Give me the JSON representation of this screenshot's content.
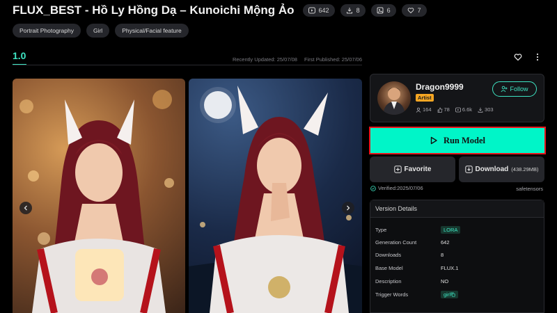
{
  "header": {
    "title": "FLUX_BEST - Hồ Ly Hồng Dạ – Kunoichi Mộng Ảo",
    "stats": [
      {
        "icon": "play-icon",
        "value": "642"
      },
      {
        "icon": "download-icon",
        "value": "8"
      },
      {
        "icon": "image-icon",
        "value": "6"
      },
      {
        "icon": "heart-icon",
        "value": "7"
      }
    ]
  },
  "tags": [
    "Portrait Photography",
    "Girl",
    "Physical/Facial feature"
  ],
  "version": {
    "label": "1.0",
    "recently_updated": "Recently Updated: 25/07/08",
    "first_published": "First Published: 25/07/06"
  },
  "creator": {
    "name": "Dragon9999",
    "badge": "Artist",
    "follow_label": "Follow",
    "stats": [
      {
        "icon": "users-icon",
        "value": "164"
      },
      {
        "icon": "like-icon",
        "value": "78"
      },
      {
        "icon": "play-icon",
        "value": "6.6k"
      },
      {
        "icon": "download-icon",
        "value": "303"
      }
    ]
  },
  "actions": {
    "run_label": "Run Model",
    "favorite_label": "Favorite",
    "download_label": "Download",
    "download_size": "(438.29MB)"
  },
  "verified": "Verified:2025/07/06",
  "format": "safetensors",
  "details": {
    "header": "Version Details",
    "rows": [
      {
        "key": "Type",
        "value": "LORA"
      },
      {
        "key": "Generation Count",
        "value": "642"
      },
      {
        "key": "Downloads",
        "value": "8"
      },
      {
        "key": "Base Model",
        "value": "FLUX.1"
      },
      {
        "key": "Description",
        "value": "NO"
      },
      {
        "key": "Trigger Words",
        "value": "girl"
      }
    ]
  },
  "colors": {
    "accent": "#3ee6c4",
    "run_button": "#00f5c8",
    "run_border": "#e8141c",
    "artist_badge": "#f5a623",
    "background": "#000000"
  }
}
